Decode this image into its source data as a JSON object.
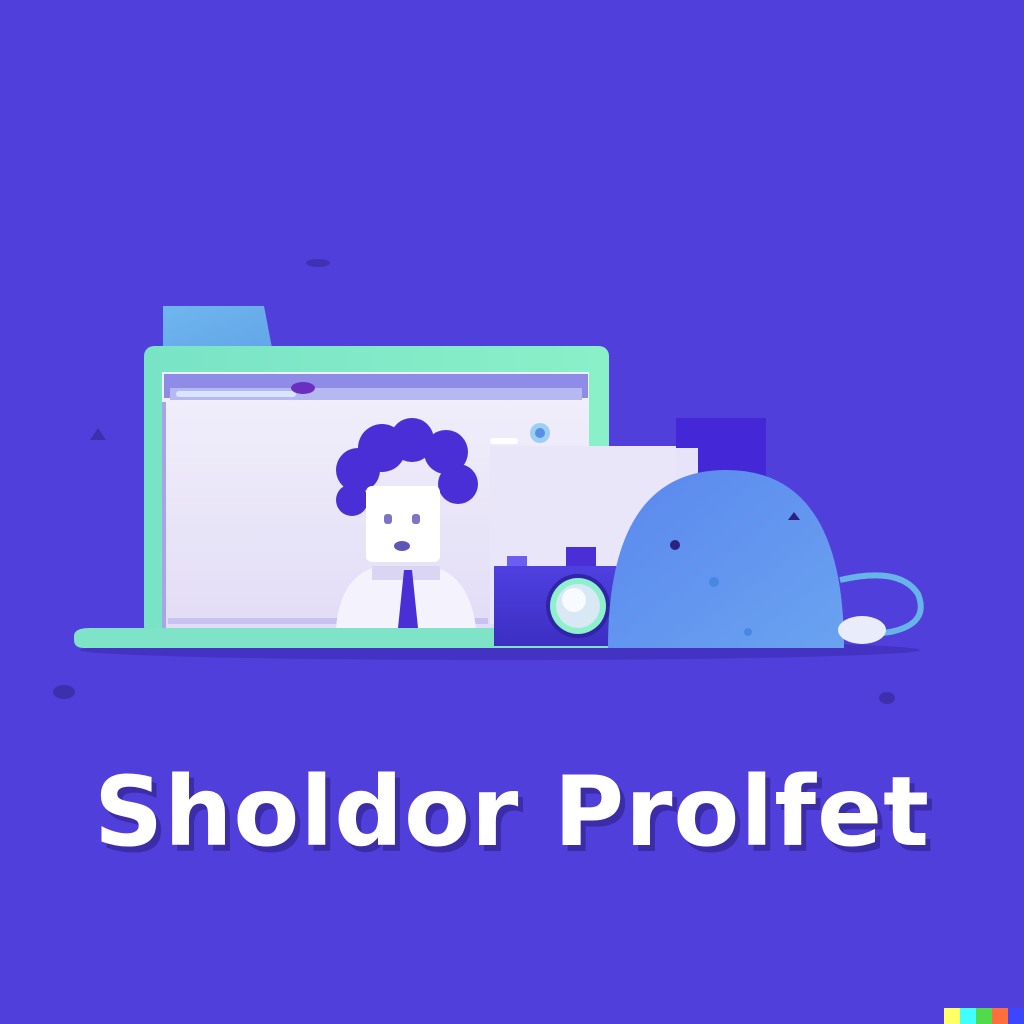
{
  "headline": "Sholdor Prolfet",
  "icons": {
    "folder": "folder-icon",
    "browser_window": "browser-window-icon",
    "person": "person-avatar-icon",
    "camera": "camera-icon",
    "mouse": "computer-mouse-icon"
  },
  "colors": {
    "background": "#513fdc",
    "headline": "#ffffff",
    "headline_shadow": "#3d2ca8",
    "folder_green": "#7de8c4",
    "screen": "#ece9f7",
    "hair": "#4a2fd6",
    "mouse_blue": "#5f8ff0",
    "camera_body": "#4637d6"
  },
  "signature_colors": [
    "#ffff66",
    "#42ffff",
    "#51da4c",
    "#ff6e3c",
    "#3c46ff"
  ]
}
